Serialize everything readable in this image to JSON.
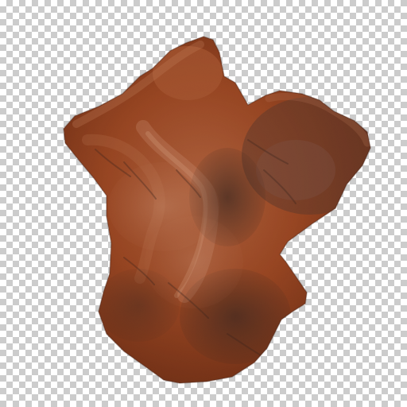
{
  "image": {
    "subject": "rock-texture",
    "background": "transparency-checkerboard",
    "colors": {
      "rust": "#8f3f1c",
      "rust_light": "#b05a2f",
      "highlight": "#d39a78",
      "shadow": "#3a2a25",
      "checker_light": "#ffffff",
      "checker_dark": "#cccccc"
    }
  }
}
